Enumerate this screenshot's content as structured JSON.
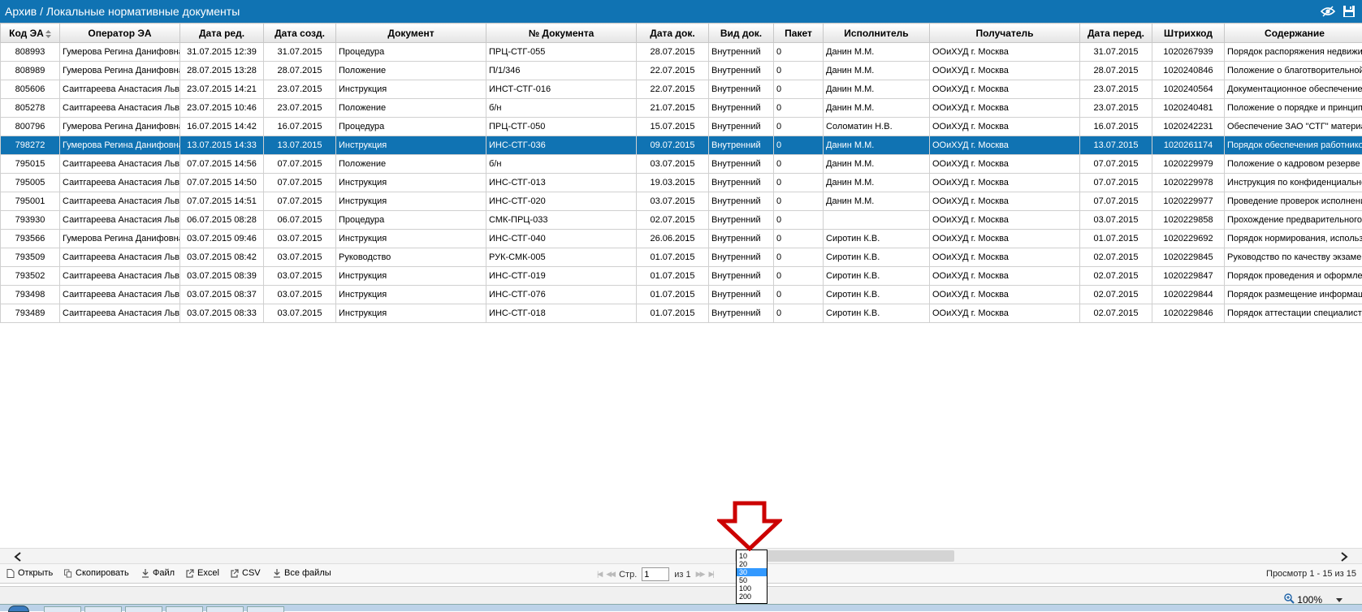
{
  "app": {
    "title": "Архив / Локальные нормативные документы"
  },
  "table": {
    "columns": [
      "Код ЭА",
      "Оператор ЭА",
      "Дата ред.",
      "Дата созд.",
      "Документ",
      "№ Документа",
      "Дата док.",
      "Вид док.",
      "Пакет",
      "Исполнитель",
      "Получатель",
      "Дата перед.",
      "Штрихкод",
      "Содержание"
    ],
    "rows": [
      [
        "808993",
        "Гумерова Регина Данифовна",
        "31.07.2015 12:39",
        "31.07.2015",
        "Процедура",
        "ПРЦ-СТГ-055",
        "28.07.2015",
        "Внутренний",
        "0",
        "Данин М.М.",
        "ООиХУД г. Москва",
        "31.07.2015",
        "1020267939",
        "Порядок распоряжения недвижимым"
      ],
      [
        "808989",
        "Гумерова Регина Данифовна",
        "28.07.2015 13:28",
        "28.07.2015",
        "Положение",
        "П/1/346",
        "22.07.2015",
        "Внутренний",
        "0",
        "Данин М.М.",
        "ООиХУД г. Москва",
        "28.07.2015",
        "1020240846",
        "Положение о благотворительной"
      ],
      [
        "805606",
        "Саитгареева Анастасия Львовна",
        "23.07.2015 14:21",
        "23.07.2015",
        "Инструкция",
        "ИНСТ-СТГ-016",
        "22.07.2015",
        "Внутренний",
        "0",
        "Данин М.М.",
        "ООиХУД г. Москва",
        "23.07.2015",
        "1020240564",
        "Документационное обеспечение"
      ],
      [
        "805278",
        "Саитгареева Анастасия Львовна",
        "23.07.2015 10:46",
        "23.07.2015",
        "Положение",
        "б/н",
        "21.07.2015",
        "Внутренний",
        "0",
        "Данин М.М.",
        "ООиХУД г. Москва",
        "23.07.2015",
        "1020240481",
        "Положение о порядке и принципах"
      ],
      [
        "800796",
        "Гумерова Регина Данифовна",
        "16.07.2015 14:42",
        "16.07.2015",
        "Процедура",
        "ПРЦ-СТГ-050",
        "15.07.2015",
        "Внутренний",
        "0",
        "Соломатин Н.В.",
        "ООиХУД г. Москва",
        "16.07.2015",
        "1020242231",
        "Обеспечение ЗАО \"СТГ\" материалами"
      ],
      [
        "798272",
        "Гумерова Регина Данифовна",
        "13.07.2015 14:33",
        "13.07.2015",
        "Инструкция",
        "ИНС-СТГ-036",
        "09.07.2015",
        "Внутренний",
        "0",
        "Данин М.М.",
        "ООиХУД г. Москва",
        "13.07.2015",
        "1020261174",
        "Порядок обеспечения работников"
      ],
      [
        "795015",
        "Саитгареева Анастасия Львовна",
        "07.07.2015 14:56",
        "07.07.2015",
        "Положение",
        "б/н",
        "03.07.2015",
        "Внутренний",
        "0",
        "Данин М.М.",
        "ООиХУД г. Москва",
        "07.07.2015",
        "1020229979",
        "Положение о кадровом резерве"
      ],
      [
        "795005",
        "Саитгареева Анастасия Львовна",
        "07.07.2015 14:50",
        "07.07.2015",
        "Инструкция",
        "ИНС-СТГ-013",
        "19.03.2015",
        "Внутренний",
        "0",
        "Данин М.М.",
        "ООиХУД г. Москва",
        "07.07.2015",
        "1020229978",
        "Инструкция по конфиденциальности"
      ],
      [
        "795001",
        "Саитгареева Анастасия Львовна",
        "07.07.2015 14:51",
        "07.07.2015",
        "Инструкция",
        "ИНС-СТГ-020",
        "03.07.2015",
        "Внутренний",
        "0",
        "Данин М.М.",
        "ООиХУД г. Москва",
        "07.07.2015",
        "1020229977",
        "Проведение проверок исполнения"
      ],
      [
        "793930",
        "Саитгареева Анастасия Львовна",
        "06.07.2015 08:28",
        "06.07.2015",
        "Процедура",
        "СМК-ПРЦ-033",
        "02.07.2015",
        "Внутренний",
        "0",
        "",
        "ООиХУД г. Москва",
        "03.07.2015",
        "1020229858",
        "Прохождение предварительного"
      ],
      [
        "793566",
        "Гумерова Регина Данифовна",
        "03.07.2015 09:46",
        "03.07.2015",
        "Инструкция",
        "ИНС-СТГ-040",
        "26.06.2015",
        "Внутренний",
        "0",
        "Сиротин К.В.",
        "ООиХУД г. Москва",
        "01.07.2015",
        "1020229692",
        "Порядок нормирования, использования"
      ],
      [
        "793509",
        "Саитгареева Анастасия Львовна",
        "03.07.2015 08:42",
        "03.07.2015",
        "Руководство",
        "РУК-СМК-005",
        "01.07.2015",
        "Внутренний",
        "0",
        "Сиротин К.В.",
        "ООиХУД г. Москва",
        "02.07.2015",
        "1020229845",
        "Руководство по качеству экзаменов"
      ],
      [
        "793502",
        "Саитгареева Анастасия Львовна",
        "03.07.2015 08:39",
        "03.07.2015",
        "Инструкция",
        "ИНС-СТГ-019",
        "01.07.2015",
        "Внутренний",
        "0",
        "Сиротин К.В.",
        "ООиХУД г. Москва",
        "02.07.2015",
        "1020229847",
        "Порядок проведения и оформления"
      ],
      [
        "793498",
        "Саитгареева Анастасия Львовна",
        "03.07.2015 08:37",
        "03.07.2015",
        "Инструкция",
        "ИНС-СТГ-076",
        "01.07.2015",
        "Внутренний",
        "0",
        "Сиротин К.В.",
        "ООиХУД г. Москва",
        "02.07.2015",
        "1020229844",
        "Порядок размещение информации"
      ],
      [
        "793489",
        "Саитгареева Анастасия Львовна",
        "03.07.2015 08:33",
        "03.07.2015",
        "Инструкция",
        "ИНС-СТГ-018",
        "01.07.2015",
        "Внутренний",
        "0",
        "Сиротин К.В.",
        "ООиХУД г. Москва",
        "02.07.2015",
        "1020229846",
        "Порядок аттестации специалистов"
      ]
    ],
    "selected_row_index": 5
  },
  "toolbar": {
    "open_label": "Открыть",
    "copy_label": "Скопировать",
    "file_label": "Файл",
    "excel_label": "Excel",
    "csv_label": "CSV",
    "all_files_label": "Все файлы"
  },
  "pager": {
    "page_label": "Стр.",
    "page_value": "1",
    "of_label": "из 1",
    "page_size_options": [
      "10",
      "20",
      "30",
      "50",
      "100",
      "200"
    ],
    "page_size_selected": "30"
  },
  "status": {
    "view_text": "Просмотр 1 - 15 из 15"
  },
  "zoom": {
    "level": "100%"
  },
  "colors": {
    "accent": "#1073b3",
    "selected_row": "#1073b3",
    "arrow": "#cc0000"
  },
  "icons": {
    "title_view": "eye-icon",
    "title_save": "save-icon",
    "sort": "sort-icon",
    "scroll_left": "chevron-left-icon",
    "scroll_right": "chevron-right-icon",
    "annotation": "arrow-down-icon"
  }
}
